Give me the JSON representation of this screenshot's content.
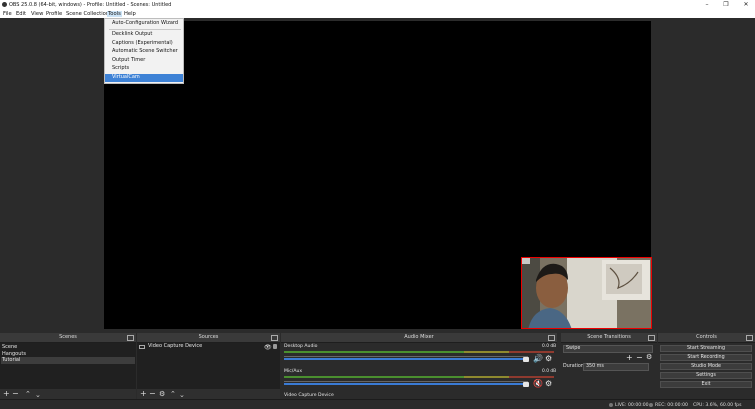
{
  "window": {
    "title": "OBS 25.0.8 (64-bit, windows) - Profile: Untitled - Scenes: Untitled",
    "minimize": "–",
    "maximize": "❐",
    "close": "✕"
  },
  "menubar": {
    "items": [
      "File",
      "Edit",
      "View",
      "Profile",
      "Scene Collection",
      "Tools",
      "Help"
    ]
  },
  "tools_menu": {
    "items": [
      "Auto-Configuration Wizard",
      "Decklink Output",
      "Captions (Experimental)",
      "Automatic Scene Switcher",
      "Output Timer",
      "Scripts",
      "VirtualCam"
    ],
    "highlighted": "VirtualCam"
  },
  "scenes": {
    "title": "Scenes",
    "items": [
      "Scene",
      "Hangouts",
      "Tutorial"
    ],
    "selected": "Tutorial"
  },
  "sources": {
    "title": "Sources",
    "items": [
      "Video Capture Device"
    ]
  },
  "audio_mixer": {
    "title": "Audio Mixer",
    "channels": [
      {
        "name": "Desktop Audio",
        "db": "0.0 dB",
        "muted": false
      },
      {
        "name": "Mic/Aux",
        "db": "0.0 dB",
        "muted": true
      },
      {
        "name": "Video Capture Device",
        "db": "",
        "muted": false
      }
    ]
  },
  "transitions": {
    "title": "Scene Transitions",
    "transition": "Swipe",
    "duration_label": "Duration",
    "duration_value": "350 ms"
  },
  "controls": {
    "title": "Controls",
    "buttons": [
      "Start Streaming",
      "Start Recording",
      "Studio Mode",
      "Settings",
      "Exit"
    ]
  },
  "status": {
    "live": "LIVE: 00:00:00",
    "rec": "REC: 00:00:00",
    "cpu": "CPU: 3.6%, 60.00 fps"
  },
  "colors": {
    "accent": "#3e82d6",
    "highlight_border": "#ee0000",
    "muted": "#d9342b"
  }
}
